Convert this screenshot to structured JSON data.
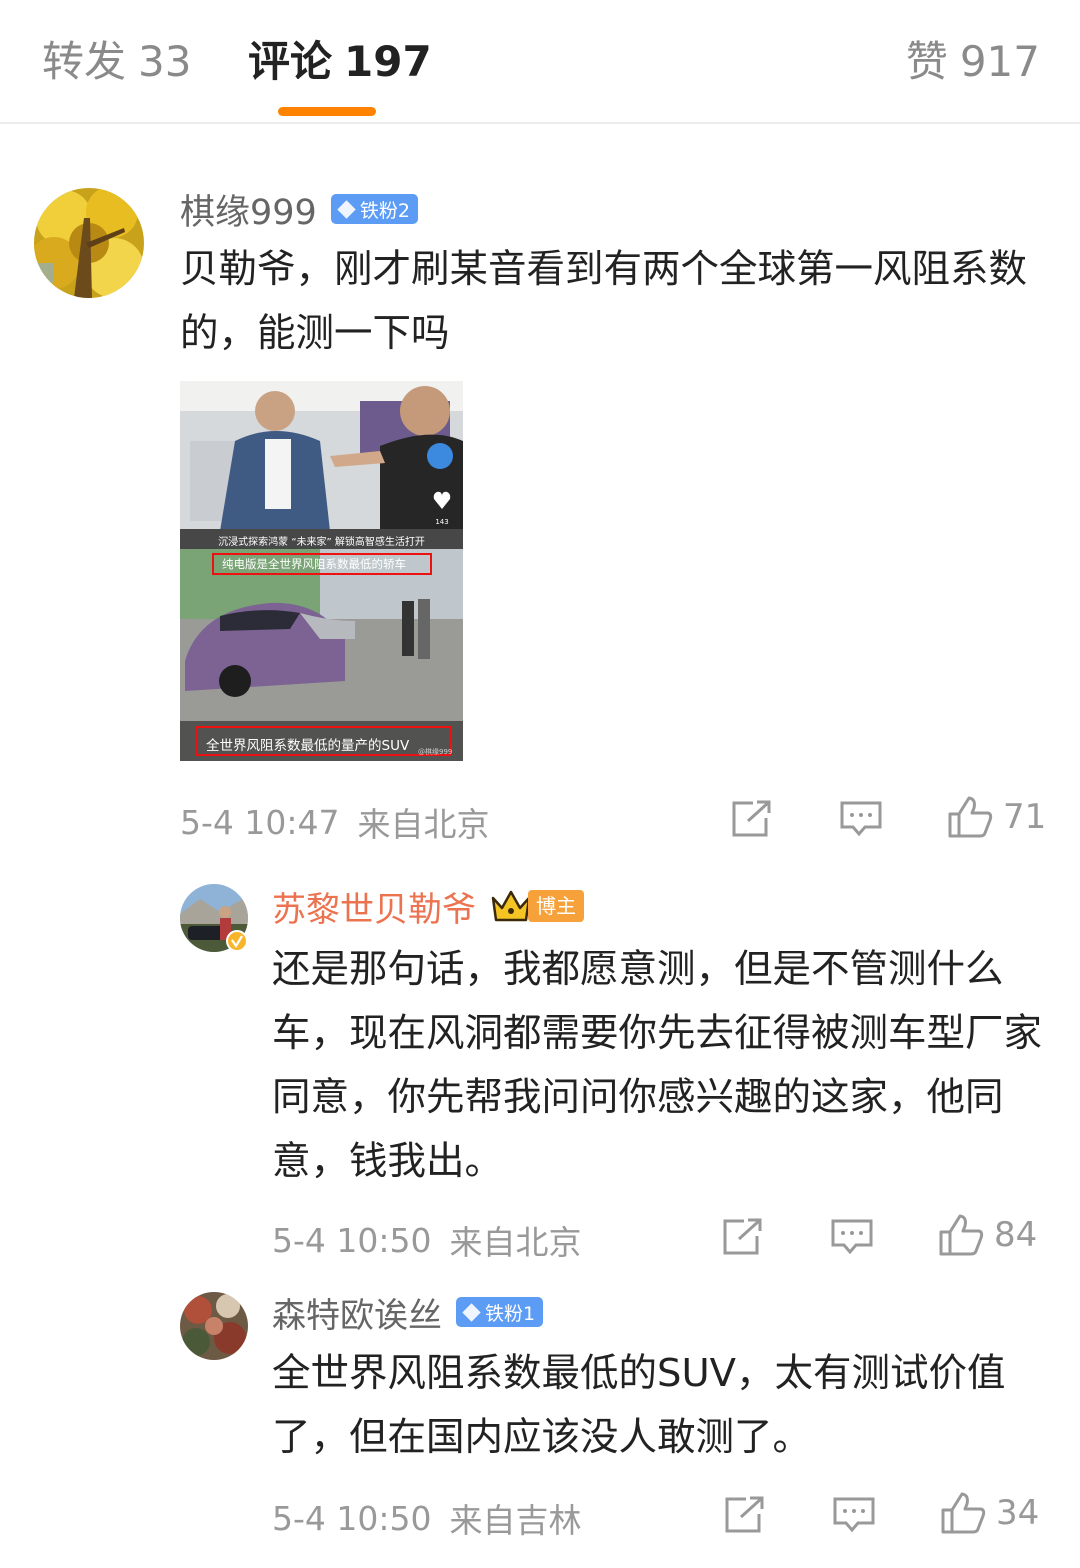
{
  "tabs": {
    "repost_label": "转发",
    "repost_count": "33",
    "comments_label": "评论",
    "comments_count": "197",
    "likes_label": "赞",
    "likes_count": "917"
  },
  "colors": {
    "accent": "#ff8200",
    "author_name": "#eb7350",
    "fan_badge": "#5c9cf5",
    "meta_text": "#999999",
    "body_text": "#222222"
  },
  "comments": [
    {
      "username": "棋缘999",
      "badge": "铁粉2",
      "text": "贝勒爷，刚才刷某音看到有两个全球第一风阻系数的，能测一下吗",
      "image": {
        "overlay_title": "沉浸式探索鸿蒙 “未来家” 解锁高智感生活打开",
        "caption_top": "纯电版是全世界风阻系数最低的轿车",
        "caption_bottom": "全世界风阻系数最低的量产的SUV",
        "like_count": "143",
        "watermark": "@棋缘999"
      },
      "date": "5-4 10:47",
      "location": "来自北京",
      "likes": "71",
      "icons": [
        "share-icon",
        "comment-icon",
        "thumb-up-icon"
      ]
    },
    {
      "username": "苏黎世贝勒爷",
      "badge": "博主",
      "text": "还是那句话，我都愿意测，但是不管测什么车，现在风洞都需要你先去征得被测车型厂家同意，你先帮我问问你感兴趣的这家，他同意，钱我出。",
      "date": "5-4 10:50",
      "location": "来自北京",
      "likes": "84",
      "icons": [
        "crown-icon",
        "verified-icon"
      ]
    },
    {
      "username": "森特欧诶丝",
      "badge": "铁粉1",
      "text": "全世界风阻系数最低的SUV，太有测试价值了，但在国内应该没人敢测了。",
      "date": "5-4 10:50",
      "location": "来自吉林",
      "likes": "34"
    }
  ]
}
